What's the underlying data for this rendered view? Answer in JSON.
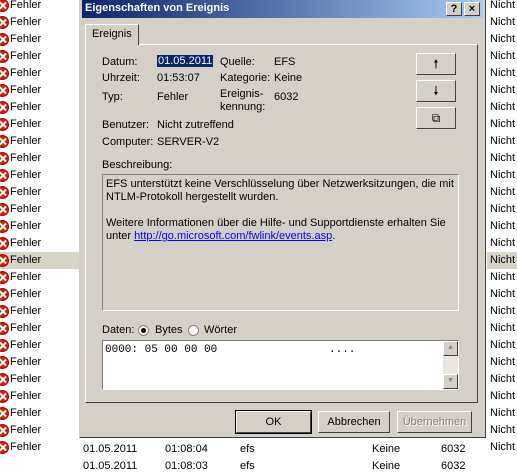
{
  "background_list": {
    "left_rows_text": "Fehler",
    "right_rows_text": "Nicht",
    "row_count": 27,
    "selected_row_index": 15,
    "bottom_rows": [
      {
        "date": "01.05.2011",
        "time": "01:08:04",
        "source": "efs",
        "category": "Keine",
        "id": "6032"
      },
      {
        "date": "01.05.2011",
        "time": "01:08:03",
        "source": "efs",
        "category": "Keine",
        "id": "6032"
      }
    ]
  },
  "dialog": {
    "title": "Eigenschaften von Ereignis",
    "help_button": "?",
    "close_button": "×",
    "tab_label": "Ereignis",
    "fields": {
      "datum_label": "Datum:",
      "datum_value": "01.05.2011",
      "uhrzeit_label": "Uhrzeit:",
      "uhrzeit_value": "01:53:07",
      "typ_label": "Typ:",
      "typ_value": "Fehler",
      "benutzer_label": "Benutzer:",
      "benutzer_value": "Nicht zutreffend",
      "computer_label": "Computer:",
      "computer_value": "SERVER-V2",
      "quelle_label": "Quelle:",
      "quelle_value": "EFS",
      "kategorie_label": "Kategorie:",
      "kategorie_value": "Keine",
      "kennung_label_1": "Ereignis-",
      "kennung_label_2": "kennung:",
      "kennung_value": "6032"
    },
    "nav_buttons": {
      "up": "🠕",
      "down": "🠗",
      "copy": "⧉"
    },
    "beschreibung_label": "Beschreibung:",
    "description": {
      "line1": "EFS unterstützt keine Verschlüsselung über Netzwerksitzungen, die mit",
      "line2": "NTLM-Protokoll hergestellt wurden.",
      "line3": "Weitere Informationen über die Hilfe- und Supportdienste erhalten Sie",
      "line4_prefix": "unter ",
      "link": "http://go.microsoft.com/fwlink/events.asp",
      "line4_suffix": "."
    },
    "data_section": {
      "label": "Daten:",
      "radio_bytes": "Bytes",
      "radio_words": "Wörter",
      "selected": "Bytes",
      "hex_line": "0000: 05 00 00 00",
      "ascii": "...."
    },
    "buttons": {
      "ok": "OK",
      "cancel": "Abbrechen",
      "apply": "Übernehmen"
    }
  }
}
